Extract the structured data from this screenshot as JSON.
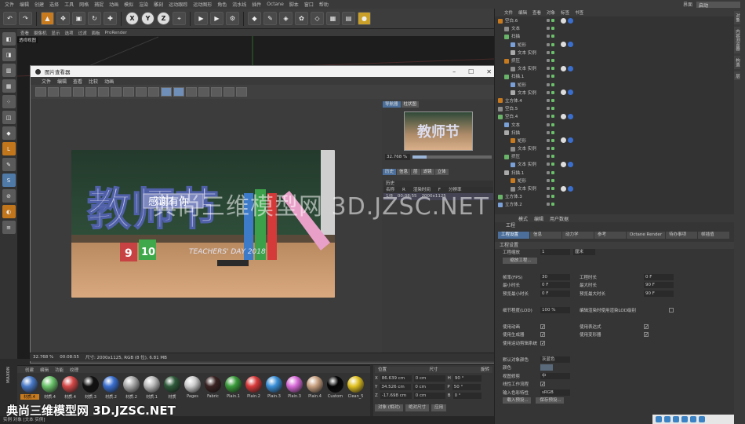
{
  "menubar": {
    "items": [
      "文件",
      "编辑",
      "创建",
      "选择",
      "工具",
      "网格",
      "捕捉",
      "动画",
      "模拟",
      "渲染",
      "雕刻",
      "运动跟踪",
      "运动图形",
      "角色",
      "流水线",
      "插件",
      "Octane",
      "脚本",
      "窗口",
      "帮助"
    ],
    "layout_label": "界面",
    "layout_value": "启动"
  },
  "toolbar": {
    "axis_buttons": [
      "X",
      "Y",
      "Z"
    ]
  },
  "viewport": {
    "menu": [
      "查看",
      "摄像机",
      "显示",
      "选项",
      "过滤",
      "面板",
      "ProRender"
    ],
    "label": "透视视图"
  },
  "picture_viewer": {
    "title": "图片查看器",
    "menu": [
      "文件",
      "编辑",
      "查看",
      "比较",
      "动画"
    ],
    "right_tabs": [
      "导航器",
      "柱状图"
    ],
    "zoom": "32.768 %",
    "history_tabs": [
      "历史",
      "信息",
      "层",
      "滤镜",
      "立体"
    ],
    "history_header": "历史",
    "history_cols": [
      "名称",
      "R",
      "渲染时间",
      "F",
      "分辨率"
    ],
    "history_row": [
      "1/8",
      "00:08:55",
      "2000x1125"
    ],
    "status_zoom": "32.768 %",
    "status_time": "00:08:55",
    "status_info": "尺寸: 2000x1125, RGB (8 位), 6.81 MB",
    "image": {
      "main_text": "教师节",
      "badge_text": "感谢有你",
      "sub_text": "TEACHERS' DAY 2018",
      "numbers": [
        "9",
        "10"
      ],
      "thumb_text": "教师节"
    }
  },
  "materials": {
    "tabs": [
      "创建",
      "编辑",
      "功能",
      "纹理"
    ],
    "items": [
      {
        "label": "材质.4",
        "color": "#4a7ac8",
        "selected": true
      },
      {
        "label": "材质.4",
        "color": "#6bc46b"
      },
      {
        "label": "材质.4",
        "color": "#d54848"
      },
      {
        "label": "材质.3",
        "color": "#111111"
      },
      {
        "label": "材质.2",
        "color": "#3a6fd0"
      },
      {
        "label": "材质.2",
        "color": "#aaaaaa"
      },
      {
        "label": "材质.1",
        "color": "#bbbbbb"
      },
      {
        "label": "材质",
        "color": "#2e5a3a"
      },
      {
        "label": "Pages",
        "color": "#cccccc"
      },
      {
        "label": "Fabric",
        "color": "#3a2222"
      },
      {
        "label": "Plain.1",
        "color": "#3a9b3a"
      },
      {
        "label": "Plain.2",
        "color": "#d83a3a"
      },
      {
        "label": "Plain.3",
        "color": "#3a8fd8"
      },
      {
        "label": "Plain.3",
        "color": "#d86ad8"
      },
      {
        "label": "Plain.4",
        "color": "#c8a080"
      },
      {
        "label": "Custom",
        "color": "#050505"
      },
      {
        "label": "Clean_5",
        "color": "#e0c020"
      }
    ]
  },
  "coordinates": {
    "headers": [
      "位置",
      "尺寸",
      "旋转"
    ],
    "rows": [
      {
        "axis": "X",
        "pos": "86.639 cm",
        "size": "0 cm",
        "rot_axis": "H",
        "rot": "90 °"
      },
      {
        "axis": "Y",
        "pos": "34.526 cm",
        "size": "0 cm",
        "rot_axis": "P",
        "rot": "50 °"
      },
      {
        "axis": "Z",
        "pos": "-17.698 cm",
        "size": "0 cm",
        "rot_axis": "B",
        "rot": "0 °"
      }
    ],
    "mode": "对象 (相对)",
    "size_mode": "绝对尺寸",
    "apply": "应用"
  },
  "object_manager": {
    "menu": [
      "文件",
      "编辑",
      "查看",
      "对象",
      "标签",
      "书签"
    ],
    "rows": [
      {
        "name": "空白.6",
        "indent": 0
      },
      {
        "name": "文本",
        "indent": 1
      },
      {
        "name": "扫描",
        "indent": 1
      },
      {
        "name": "矩形",
        "indent": 2
      },
      {
        "name": "文本 实例",
        "indent": 2
      },
      {
        "name": "挤压",
        "indent": 1
      },
      {
        "name": "文本 实例",
        "indent": 2
      },
      {
        "name": "扫描.1",
        "indent": 1
      },
      {
        "name": "矩形",
        "indent": 2
      },
      {
        "name": "文本 实例",
        "indent": 2
      },
      {
        "name": "立方体.4",
        "indent": 0
      },
      {
        "name": "空白.5",
        "indent": 0
      },
      {
        "name": "空白.4",
        "indent": 0
      },
      {
        "name": "文本",
        "indent": 1
      },
      {
        "name": "扫描",
        "indent": 1
      },
      {
        "name": "矩形",
        "indent": 2
      },
      {
        "name": "文本 实例",
        "indent": 2
      },
      {
        "name": "挤压",
        "indent": 1
      },
      {
        "name": "文本 实例",
        "indent": 2
      },
      {
        "name": "扫描.1",
        "indent": 1
      },
      {
        "name": "矩形",
        "indent": 2
      },
      {
        "name": "文本 实例",
        "indent": 2
      },
      {
        "name": "立方体.3",
        "indent": 0
      },
      {
        "name": "立方体.2",
        "indent": 0
      }
    ]
  },
  "attributes": {
    "header": [
      "模式",
      "编辑",
      "用户数据"
    ],
    "title": "工程",
    "tabs": [
      "工程设置",
      "信息",
      "动力学",
      "参考",
      "Octane Render",
      "待办事项",
      "帧插值"
    ],
    "section": "工程设置",
    "scale_label": "工程缩放",
    "scale_value": "1",
    "scale_unit": "厘米",
    "scale_button": "缩放工程...",
    "fps_label": "帧率(FPS)",
    "fps_value": "30",
    "project_time_label": "工程时长",
    "project_time_value": "0 F",
    "min_time_label": "最小时长",
    "min_time_value": "0 F",
    "max_time_label": "最大时长",
    "max_time_value": "90 F",
    "preview_min_label": "预览最小时长",
    "preview_min_value": "0 F",
    "preview_max_label": "预览最大时长",
    "preview_max_value": "90 F",
    "lod_label": "细节程度(LOD)",
    "lod_value": "100 %",
    "lod_render_label": "编辑渲染时使用渲染LOD级别",
    "checks": [
      {
        "label": "使用动画",
        "value": "✓"
      },
      {
        "label": "使用表达式",
        "value": "✓"
      },
      {
        "label": "使用生成器",
        "value": "✓"
      },
      {
        "label": "使用变形器",
        "value": "✓"
      },
      {
        "label": "使用运动剪辑系统",
        "value": "✓"
      }
    ],
    "default_color_label": "默认对象颜色",
    "default_color_value": "灰蓝色",
    "color_label": "颜色",
    "clip_label": "视图修剪",
    "clip_value": "中",
    "linear_label": "线性工作流程",
    "linear_value": "✓",
    "input_color_label": "输入色彩特性",
    "input_color_value": "sRGB",
    "load_preset": "载入预设...",
    "save_preset": "保存预设..."
  },
  "right_strip": [
    "对象",
    "内容浏览器",
    "构造",
    "层"
  ],
  "statusbar": "实例 对象 [文本 实例]",
  "watermarks": {
    "center": "典尚三维模型网 3D.JZSC.NET",
    "corner": "典尚三维模型网 3D.JZSC.NET"
  }
}
